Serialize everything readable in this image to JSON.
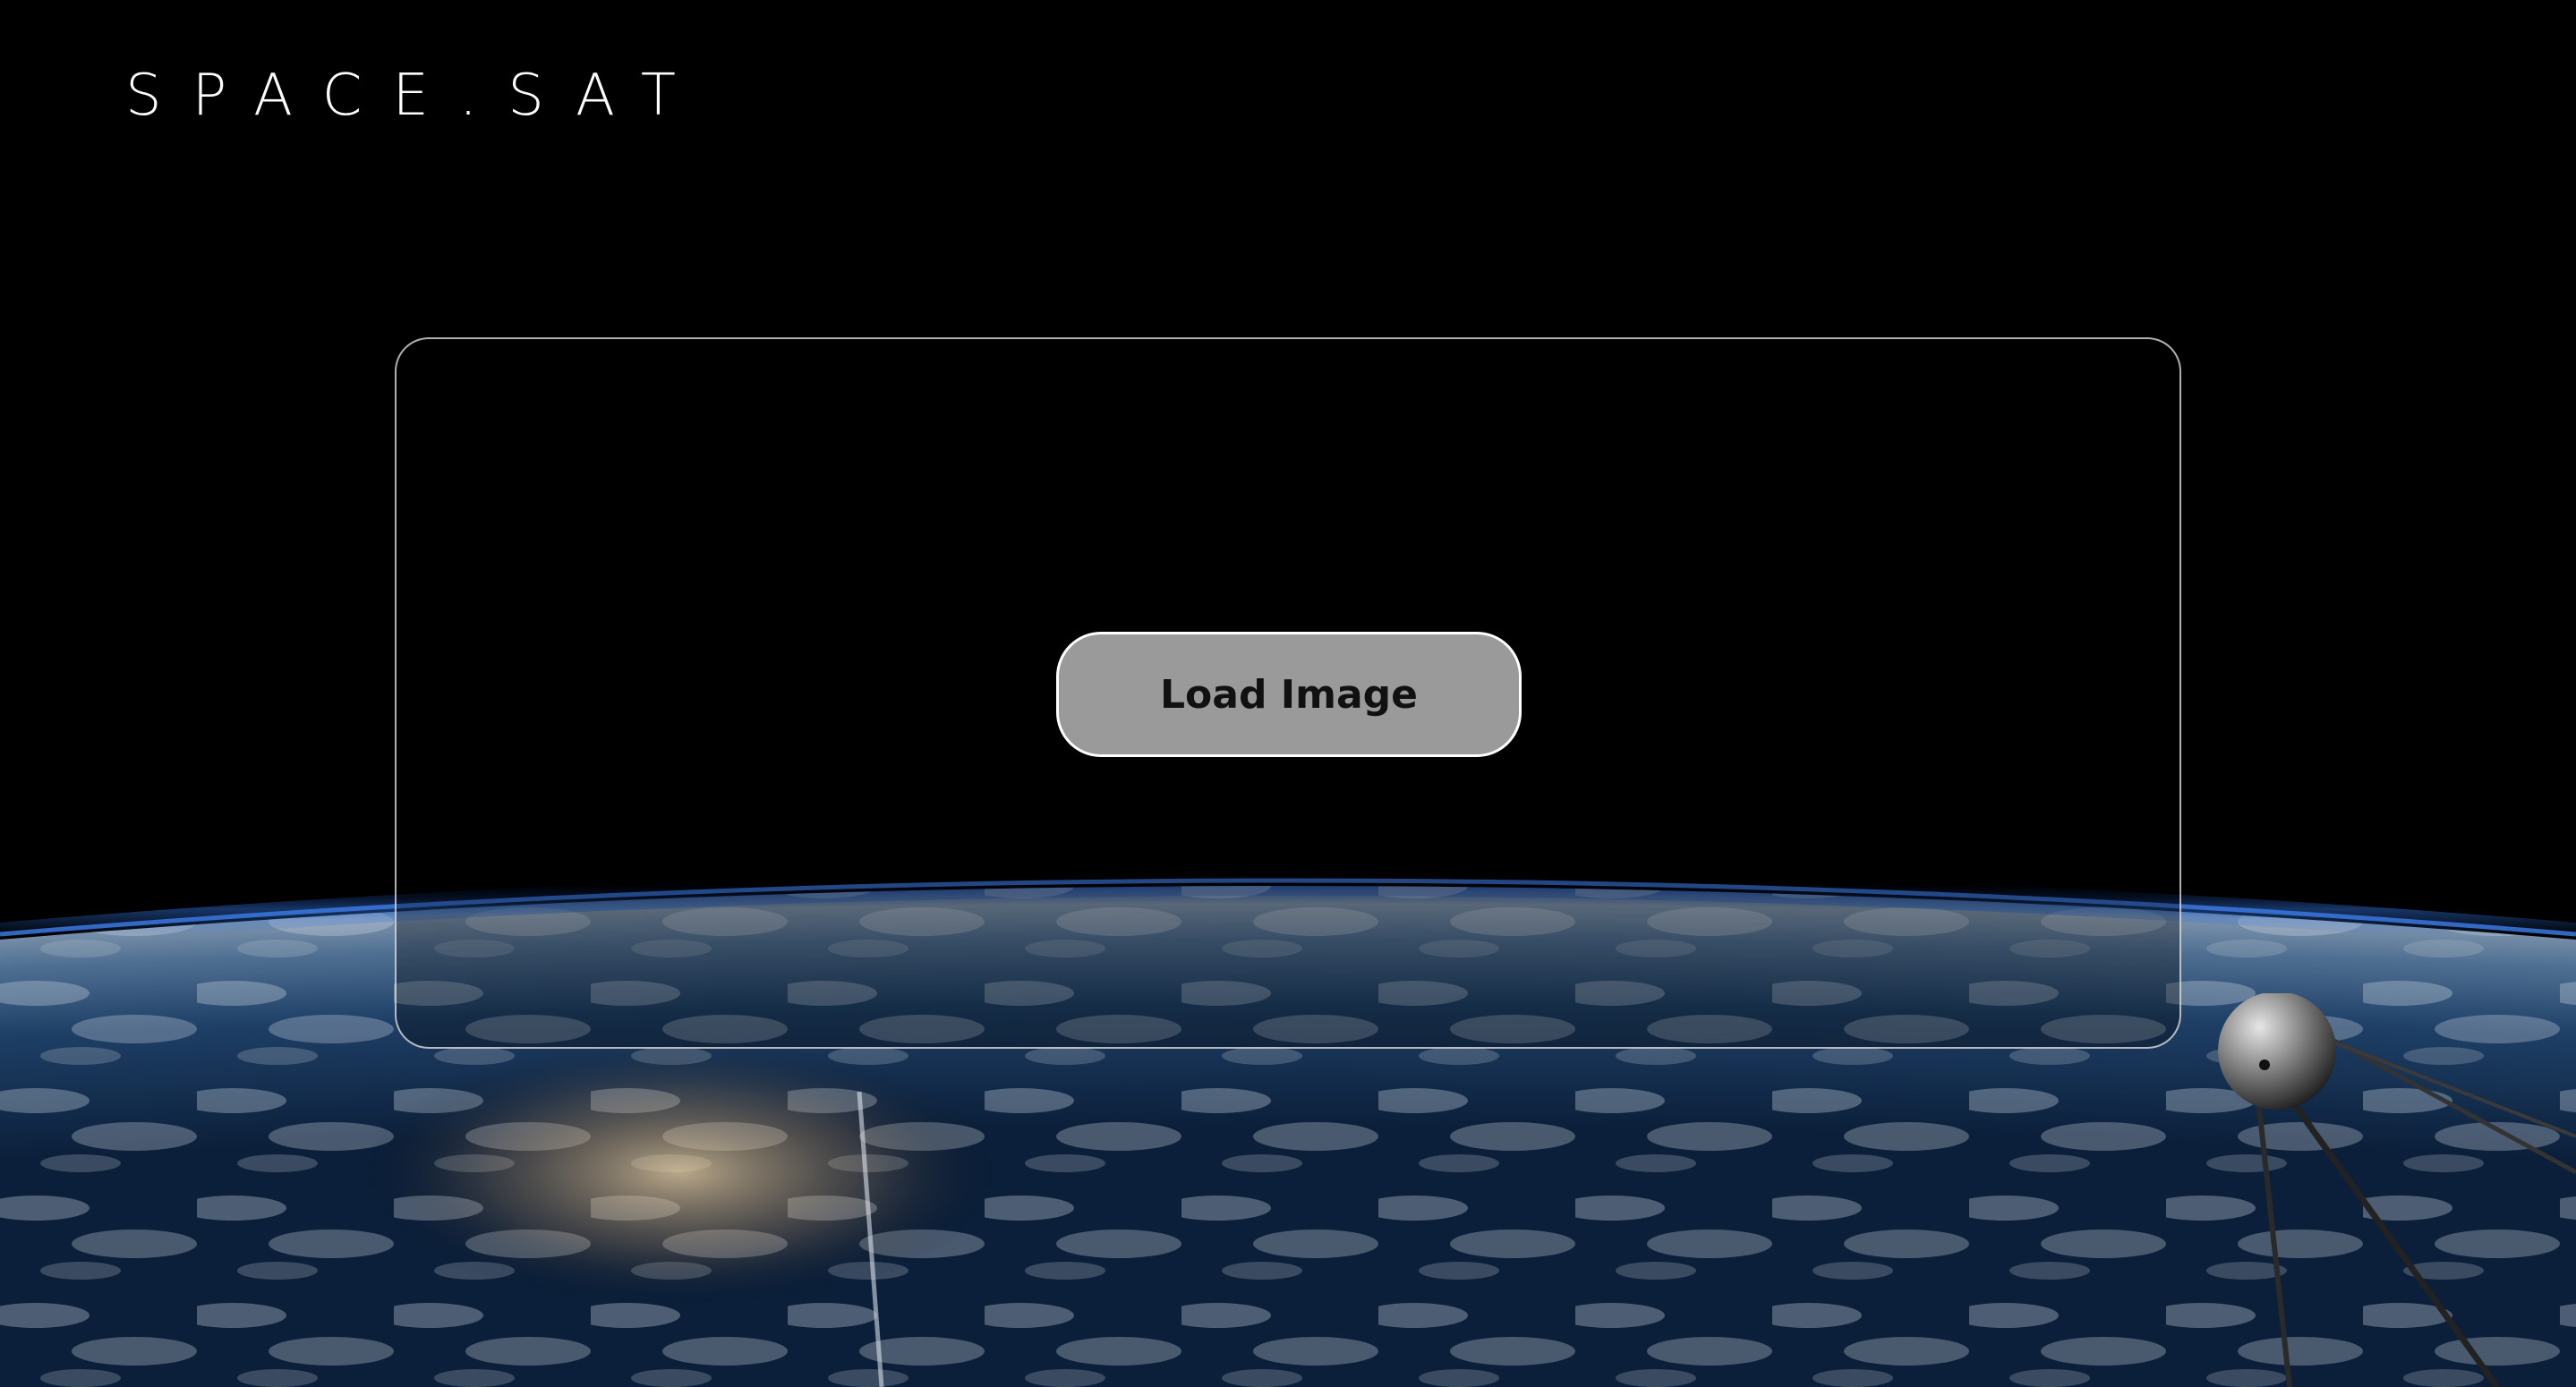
{
  "header": {
    "logo_text": "SPACE.SAT"
  },
  "main": {
    "load_button_label": "Load Image"
  },
  "background": {
    "scene": "earth-horizon-from-orbit",
    "satellite_icon": "sputnik-satellite-icon"
  },
  "colors": {
    "background": "#000000",
    "panel_border": "#ebebeb",
    "button_fill": "#9a9a9a",
    "button_text": "#111111"
  }
}
